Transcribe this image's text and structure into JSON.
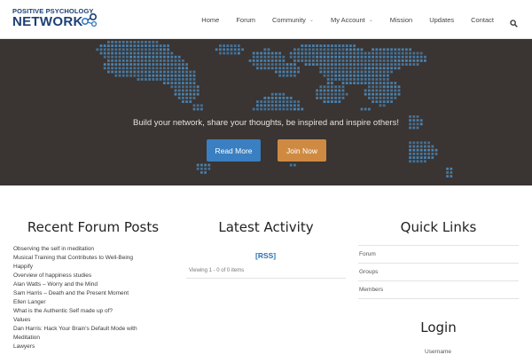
{
  "logo": {
    "line1": "POSITIVE PSYCHOLOGY",
    "line2": "NETWORK"
  },
  "nav": {
    "items": [
      {
        "label": "Home",
        "has_caret": false
      },
      {
        "label": "Forum",
        "has_caret": false
      },
      {
        "label": "Community",
        "has_caret": true
      },
      {
        "label": "My Account",
        "has_caret": true
      },
      {
        "label": "Mission",
        "has_caret": false
      },
      {
        "label": "Updates",
        "has_caret": false
      },
      {
        "label": "Contact",
        "has_caret": false
      }
    ],
    "search_icon": "search-icon"
  },
  "hero": {
    "tagline": "Build your network, share your thoughts, be inspired and inspire others!",
    "read_more": "Read More",
    "join_now": "Join Now",
    "map_color": "#4a86b5",
    "background_color": "#3a3432"
  },
  "forum": {
    "title": "Recent Forum Posts",
    "posts": [
      "Observing the self in meditation",
      "Musical Training that Contributes to Well-Being",
      "Happify",
      "Overview of happiness studies",
      "Alan Watts – Worry and the Mind",
      "Sam Harris – Death and the Present Moment",
      "Ellen Langer",
      "What is the Authentic Self made up of?",
      "Values",
      "Dan Harris: Hack Your Brain's Default Mode with",
      "Meditation",
      "Lawyers"
    ]
  },
  "activity": {
    "title": "Latest Activity",
    "rss": "[RSS]",
    "viewing": "Viewing 1 - 0 of 0 items"
  },
  "quick_links": {
    "title": "Quick Links",
    "items": [
      "Forum",
      "Groups",
      "Members"
    ]
  },
  "login": {
    "title": "Login",
    "username_label": "Username"
  },
  "colors": {
    "accent_blue": "#3a7fc1",
    "accent_orange": "#cf8a42",
    "brand_navy": "#1d3f74"
  }
}
